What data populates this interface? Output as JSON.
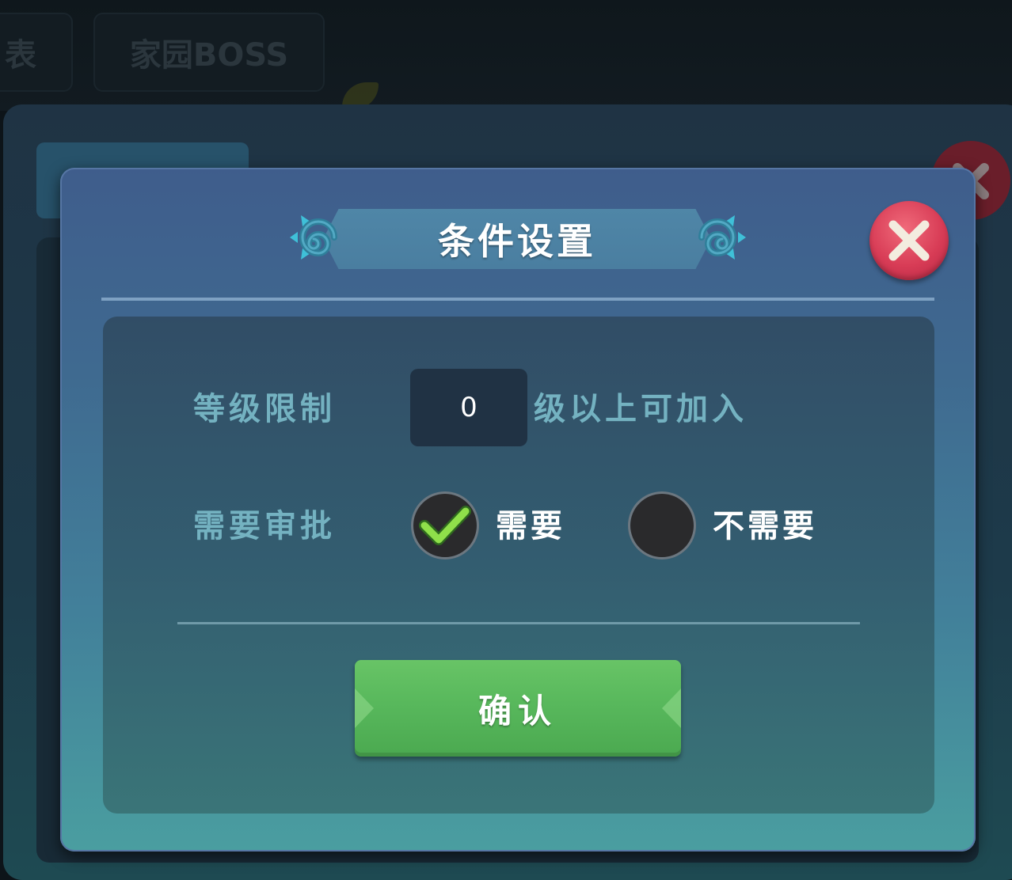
{
  "background": {
    "tabs": [
      "表",
      "家园BOSS"
    ]
  },
  "dialog": {
    "title": "条件设置",
    "level_limit": {
      "label": "等级限制",
      "value": "0",
      "suffix": "级以上可加入"
    },
    "approval": {
      "label": "需要审批",
      "options": [
        {
          "label": "需要",
          "selected": true
        },
        {
          "label": "不需要",
          "selected": false
        }
      ]
    },
    "confirm_label": "确认"
  },
  "icons": {
    "close": "close-icon",
    "check": "checkmark-icon",
    "ornament": "swirl-ornament-icon"
  },
  "colors": {
    "accent_green": "#5cb85c",
    "close_red": "#d83c56",
    "label_teal": "#74b2c1"
  }
}
